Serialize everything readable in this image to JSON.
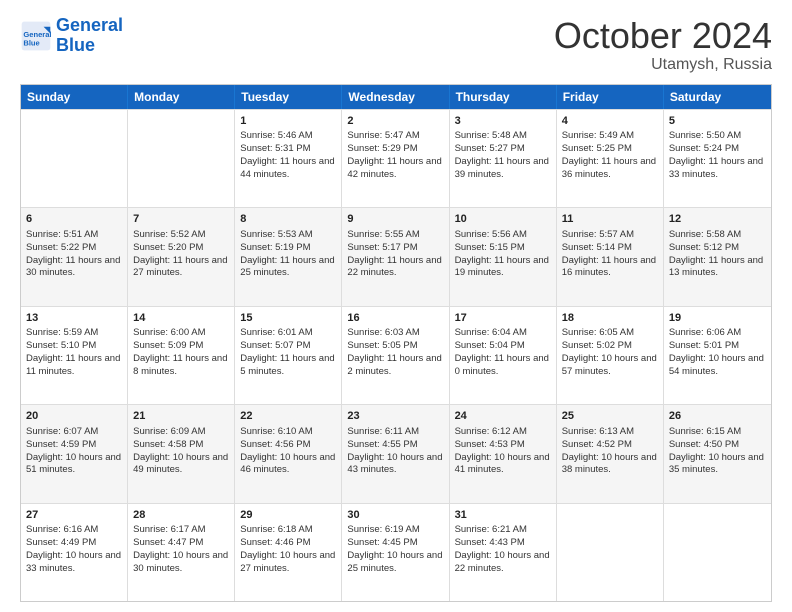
{
  "logo": {
    "line1": "General",
    "line2": "Blue"
  },
  "title": "October 2024",
  "location": "Utamysh, Russia",
  "days_of_week": [
    "Sunday",
    "Monday",
    "Tuesday",
    "Wednesday",
    "Thursday",
    "Friday",
    "Saturday"
  ],
  "weeks": [
    [
      {
        "day": "",
        "sunrise": "",
        "sunset": "",
        "daylight": ""
      },
      {
        "day": "",
        "sunrise": "",
        "sunset": "",
        "daylight": ""
      },
      {
        "day": "1",
        "sunrise": "Sunrise: 5:46 AM",
        "sunset": "Sunset: 5:31 PM",
        "daylight": "Daylight: 11 hours and 44 minutes."
      },
      {
        "day": "2",
        "sunrise": "Sunrise: 5:47 AM",
        "sunset": "Sunset: 5:29 PM",
        "daylight": "Daylight: 11 hours and 42 minutes."
      },
      {
        "day": "3",
        "sunrise": "Sunrise: 5:48 AM",
        "sunset": "Sunset: 5:27 PM",
        "daylight": "Daylight: 11 hours and 39 minutes."
      },
      {
        "day": "4",
        "sunrise": "Sunrise: 5:49 AM",
        "sunset": "Sunset: 5:25 PM",
        "daylight": "Daylight: 11 hours and 36 minutes."
      },
      {
        "day": "5",
        "sunrise": "Sunrise: 5:50 AM",
        "sunset": "Sunset: 5:24 PM",
        "daylight": "Daylight: 11 hours and 33 minutes."
      }
    ],
    [
      {
        "day": "6",
        "sunrise": "Sunrise: 5:51 AM",
        "sunset": "Sunset: 5:22 PM",
        "daylight": "Daylight: 11 hours and 30 minutes."
      },
      {
        "day": "7",
        "sunrise": "Sunrise: 5:52 AM",
        "sunset": "Sunset: 5:20 PM",
        "daylight": "Daylight: 11 hours and 27 minutes."
      },
      {
        "day": "8",
        "sunrise": "Sunrise: 5:53 AM",
        "sunset": "Sunset: 5:19 PM",
        "daylight": "Daylight: 11 hours and 25 minutes."
      },
      {
        "day": "9",
        "sunrise": "Sunrise: 5:55 AM",
        "sunset": "Sunset: 5:17 PM",
        "daylight": "Daylight: 11 hours and 22 minutes."
      },
      {
        "day": "10",
        "sunrise": "Sunrise: 5:56 AM",
        "sunset": "Sunset: 5:15 PM",
        "daylight": "Daylight: 11 hours and 19 minutes."
      },
      {
        "day": "11",
        "sunrise": "Sunrise: 5:57 AM",
        "sunset": "Sunset: 5:14 PM",
        "daylight": "Daylight: 11 hours and 16 minutes."
      },
      {
        "day": "12",
        "sunrise": "Sunrise: 5:58 AM",
        "sunset": "Sunset: 5:12 PM",
        "daylight": "Daylight: 11 hours and 13 minutes."
      }
    ],
    [
      {
        "day": "13",
        "sunrise": "Sunrise: 5:59 AM",
        "sunset": "Sunset: 5:10 PM",
        "daylight": "Daylight: 11 hours and 11 minutes."
      },
      {
        "day": "14",
        "sunrise": "Sunrise: 6:00 AM",
        "sunset": "Sunset: 5:09 PM",
        "daylight": "Daylight: 11 hours and 8 minutes."
      },
      {
        "day": "15",
        "sunrise": "Sunrise: 6:01 AM",
        "sunset": "Sunset: 5:07 PM",
        "daylight": "Daylight: 11 hours and 5 minutes."
      },
      {
        "day": "16",
        "sunrise": "Sunrise: 6:03 AM",
        "sunset": "Sunset: 5:05 PM",
        "daylight": "Daylight: 11 hours and 2 minutes."
      },
      {
        "day": "17",
        "sunrise": "Sunrise: 6:04 AM",
        "sunset": "Sunset: 5:04 PM",
        "daylight": "Daylight: 11 hours and 0 minutes."
      },
      {
        "day": "18",
        "sunrise": "Sunrise: 6:05 AM",
        "sunset": "Sunset: 5:02 PM",
        "daylight": "Daylight: 10 hours and 57 minutes."
      },
      {
        "day": "19",
        "sunrise": "Sunrise: 6:06 AM",
        "sunset": "Sunset: 5:01 PM",
        "daylight": "Daylight: 10 hours and 54 minutes."
      }
    ],
    [
      {
        "day": "20",
        "sunrise": "Sunrise: 6:07 AM",
        "sunset": "Sunset: 4:59 PM",
        "daylight": "Daylight: 10 hours and 51 minutes."
      },
      {
        "day": "21",
        "sunrise": "Sunrise: 6:09 AM",
        "sunset": "Sunset: 4:58 PM",
        "daylight": "Daylight: 10 hours and 49 minutes."
      },
      {
        "day": "22",
        "sunrise": "Sunrise: 6:10 AM",
        "sunset": "Sunset: 4:56 PM",
        "daylight": "Daylight: 10 hours and 46 minutes."
      },
      {
        "day": "23",
        "sunrise": "Sunrise: 6:11 AM",
        "sunset": "Sunset: 4:55 PM",
        "daylight": "Daylight: 10 hours and 43 minutes."
      },
      {
        "day": "24",
        "sunrise": "Sunrise: 6:12 AM",
        "sunset": "Sunset: 4:53 PM",
        "daylight": "Daylight: 10 hours and 41 minutes."
      },
      {
        "day": "25",
        "sunrise": "Sunrise: 6:13 AM",
        "sunset": "Sunset: 4:52 PM",
        "daylight": "Daylight: 10 hours and 38 minutes."
      },
      {
        "day": "26",
        "sunrise": "Sunrise: 6:15 AM",
        "sunset": "Sunset: 4:50 PM",
        "daylight": "Daylight: 10 hours and 35 minutes."
      }
    ],
    [
      {
        "day": "27",
        "sunrise": "Sunrise: 6:16 AM",
        "sunset": "Sunset: 4:49 PM",
        "daylight": "Daylight: 10 hours and 33 minutes."
      },
      {
        "day": "28",
        "sunrise": "Sunrise: 6:17 AM",
        "sunset": "Sunset: 4:47 PM",
        "daylight": "Daylight: 10 hours and 30 minutes."
      },
      {
        "day": "29",
        "sunrise": "Sunrise: 6:18 AM",
        "sunset": "Sunset: 4:46 PM",
        "daylight": "Daylight: 10 hours and 27 minutes."
      },
      {
        "day": "30",
        "sunrise": "Sunrise: 6:19 AM",
        "sunset": "Sunset: 4:45 PM",
        "daylight": "Daylight: 10 hours and 25 minutes."
      },
      {
        "day": "31",
        "sunrise": "Sunrise: 6:21 AM",
        "sunset": "Sunset: 4:43 PM",
        "daylight": "Daylight: 10 hours and 22 minutes."
      },
      {
        "day": "",
        "sunrise": "",
        "sunset": "",
        "daylight": ""
      },
      {
        "day": "",
        "sunrise": "",
        "sunset": "",
        "daylight": ""
      }
    ]
  ]
}
